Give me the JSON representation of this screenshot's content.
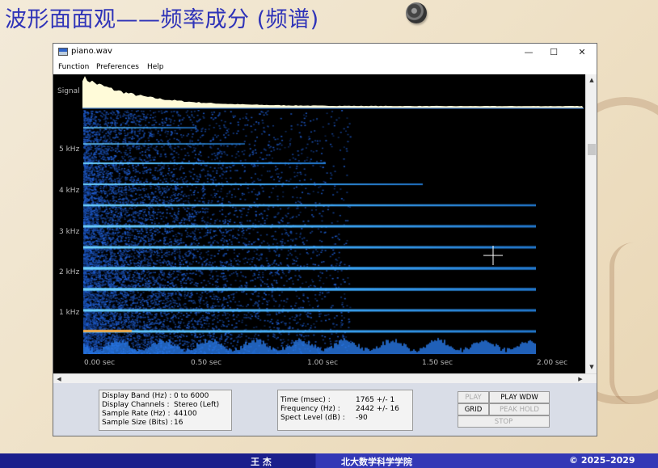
{
  "slide": {
    "title": "波形面面观——频率成分 (频谱)",
    "icon": "speaker-icon"
  },
  "window": {
    "title": "piano.wav",
    "minimize": "—",
    "maximize": "☐",
    "close": "✕",
    "menu": [
      "Function",
      "Preferences",
      "Help"
    ]
  },
  "plot": {
    "signal_label": "Signal",
    "y_labels": [
      "5 kHz",
      "4 kHz",
      "3 kHz",
      "2 kHz",
      "1 kHz"
    ],
    "x_labels": [
      "0.00 sec",
      "0.50 sec",
      "1.00 sec",
      "1.50 sec",
      "2.00 sec"
    ],
    "colors": {
      "background": "#000000",
      "waveform": "#fffbd9",
      "harmonic": "#2fb6ff"
    }
  },
  "info_left": [
    {
      "label": "Display Band (Hz) :",
      "value": "0 to 6000"
    },
    {
      "label": "Display Channels :",
      "value": "Stereo (Left)"
    },
    {
      "label": "Sample Rate (Hz) :",
      "value": "44100"
    },
    {
      "label": "Sample Size (Bits) :",
      "value": "16"
    }
  ],
  "info_mid": [
    {
      "label": "Time (msec) :",
      "value": "1765 +/- 1"
    },
    {
      "label": "Frequency (Hz) :",
      "value": "2442 +/- 16"
    },
    {
      "label": "Spect Level (dB) :",
      "value": "-90"
    }
  ],
  "buttons": {
    "play": "PLAY",
    "play_wdw": "PLAY WDW",
    "grid": "GRID",
    "peak_hold": "PEAK HOLD",
    "stop": "STOP"
  },
  "footer": {
    "author": "王    杰",
    "school": "北大数学科学学院",
    "copyright": "© 2025–2029"
  }
}
